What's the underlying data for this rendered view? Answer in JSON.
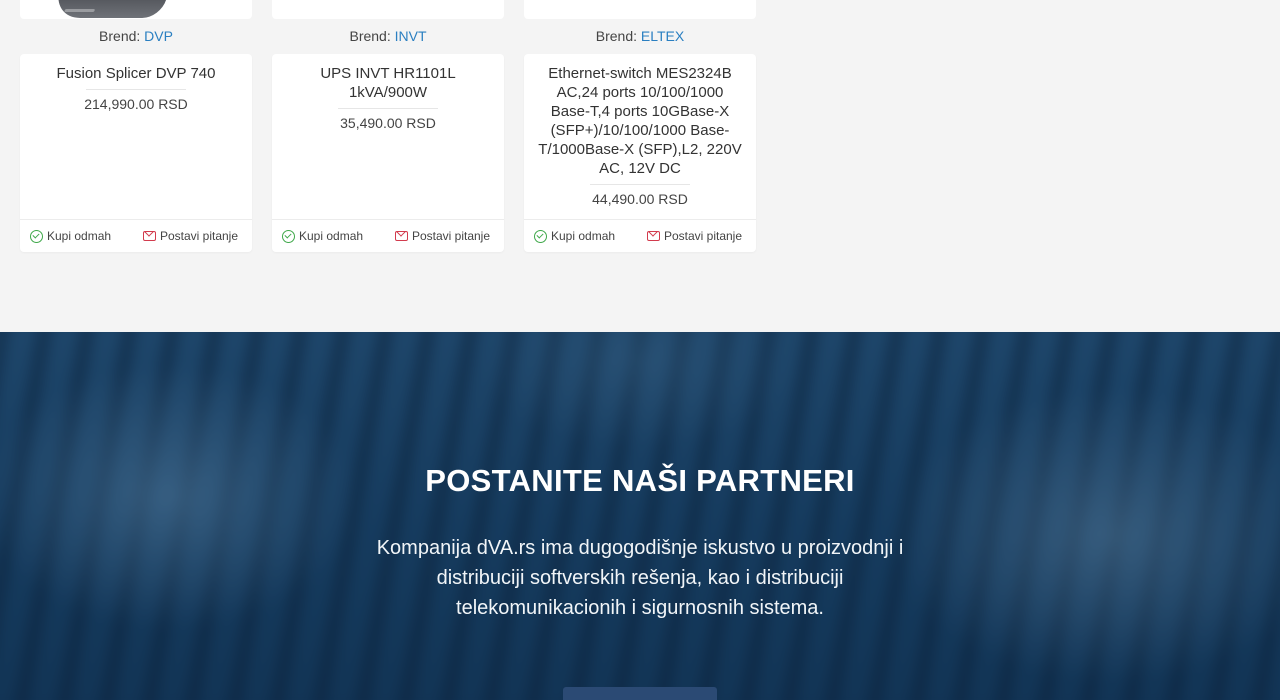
{
  "products": [
    {
      "brand_label": "Brend:",
      "brand": "DVP",
      "title": "Fusion Splicer DVP 740",
      "price": "214,990.00 RSD",
      "buy_label": "Kupi odmah",
      "ask_label": "Postavi pitanje"
    },
    {
      "brand_label": "Brend:",
      "brand": "INVT",
      "title": "UPS INVT HR1101L 1kVA/900W",
      "price": "35,490.00 RSD",
      "buy_label": "Kupi odmah",
      "ask_label": "Postavi pitanje"
    },
    {
      "brand_label": "Brend:",
      "brand": "ELTEX",
      "title": "Ethernet-switch MES2324B AC,24 ports 10/100/1000 Base-T,4 ports 10GBase-X (SFP+)/10/100/1000 Base-T/1000Base-X (SFP),L2, 220V AC, 12V DC",
      "price": "44,490.00 RSD",
      "buy_label": "Kupi odmah",
      "ask_label": "Postavi pitanje"
    }
  ],
  "partner_banner": {
    "title": "POSTANITE NAŠI PARTNERI",
    "text": "Kompanija dVA.rs ima dugogodišnje iskustvo u proizvodnji i distribuciji softverskih rešenja, kao i distribuciji telekomunikacionih i sigurnosnih sistema."
  },
  "colors": {
    "brand_link": "#2a7fc1",
    "buy_icon": "#3fa84a",
    "ask_icon": "#d23b4d",
    "banner_button": "#2b4a74"
  }
}
